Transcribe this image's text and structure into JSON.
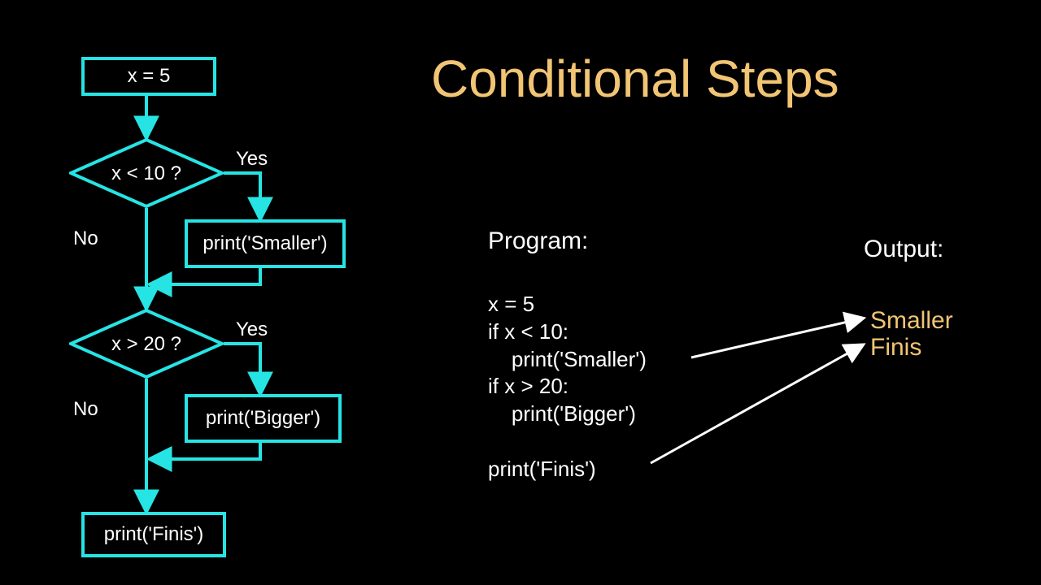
{
  "title": "Conditional Steps",
  "flow": {
    "start_box": "x = 5",
    "decision1": "x < 10 ?",
    "yes1": "Yes",
    "no1": "No",
    "action1": "print('Smaller')",
    "decision2": "x > 20 ?",
    "yes2": "Yes",
    "no2": "No",
    "action2": "print('Bigger')",
    "final_box": "print('Finis')"
  },
  "program": {
    "label": "Program:",
    "code": "x = 5\nif x < 10:\n    print('Smaller')\nif x > 20:\n    print('Bigger')\n\nprint('Finis')"
  },
  "output": {
    "label": "Output:",
    "lines": "Smaller\nFinis"
  },
  "colors": {
    "accent": "#27e4e4",
    "title": "#f2c574"
  }
}
